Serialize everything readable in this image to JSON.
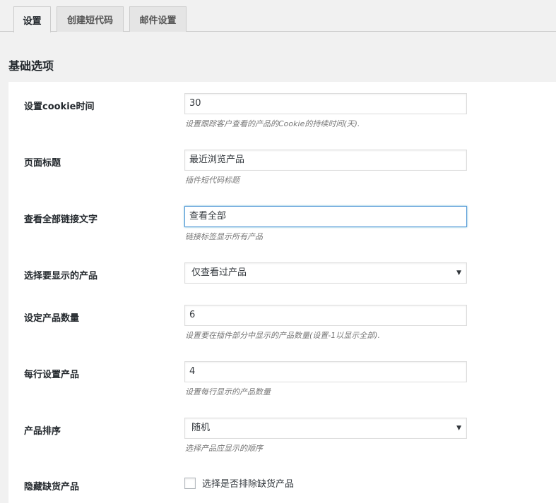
{
  "tabs": [
    {
      "label": "设置",
      "active": true
    },
    {
      "label": "创建短代码",
      "active": false
    },
    {
      "label": "邮件设置",
      "active": false
    }
  ],
  "section_title": "基础选项",
  "settings": {
    "cookie_time": {
      "label": "设置cookie时间",
      "value": "30",
      "description": "设置跟踪客户查看的产品的Cookie的持续时间(天)."
    },
    "page_title": {
      "label": "页面标题",
      "value": "最近浏览产品",
      "description": "插件短代码标题"
    },
    "view_all_text": {
      "label": "查看全部链接文字",
      "value": "查看全部",
      "description": "链接标签显示所有产品"
    },
    "products_to_show": {
      "label": "选择要显示的产品",
      "selected": "仅查看过产品"
    },
    "product_count": {
      "label": "设定产品数量",
      "value": "6",
      "description": "设置要在插件部分中显示的产品数量(设置-1以显示全部)."
    },
    "products_per_row": {
      "label": "每行设置产品",
      "value": "4",
      "description": "设置每行显示的产品数量"
    },
    "product_order": {
      "label": "产品排序",
      "selected": "随机",
      "description": "选择产品应显示的顺序"
    },
    "hide_out_of_stock": {
      "label": "隐藏缺货产品",
      "checkbox_label": "选择是否排除缺货产品",
      "checked": false
    }
  },
  "icons": {
    "dropdown": "caret-down-icon"
  },
  "colors": {
    "focus_border": "#5b9dd9",
    "background": "#f1f1f1",
    "panel": "#ffffff"
  }
}
